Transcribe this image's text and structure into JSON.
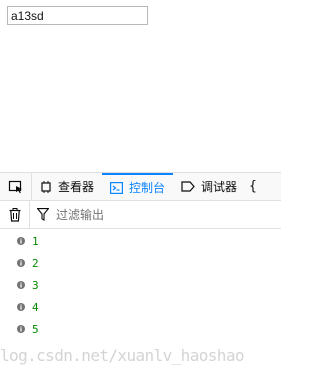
{
  "page": {
    "input_value": "a13sd"
  },
  "devtools": {
    "tabs": [
      {
        "label": "查看器",
        "icon": "inspector-icon"
      },
      {
        "label": "控制台",
        "icon": "console-icon",
        "active": true
      },
      {
        "label": "调试器",
        "icon": "debugger-icon"
      },
      {
        "label": "{",
        "icon": "style-editor-icon"
      }
    ],
    "filter_placeholder": "过滤输出",
    "log": [
      "1",
      "2",
      "3",
      "4",
      "5"
    ],
    "colors": {
      "accent": "#0a84ff",
      "log_text": "#058b00"
    }
  },
  "watermark": "log.csdn.net/xuanlv_haoshao"
}
